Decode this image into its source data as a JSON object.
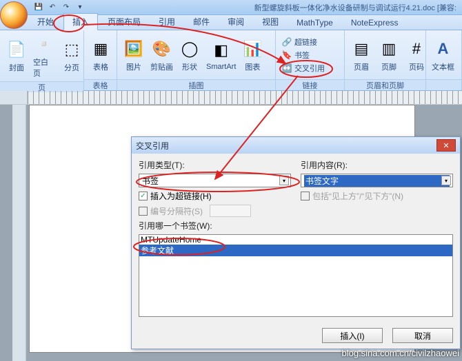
{
  "title_doc": "新型螺旋斜板一体化净水设备研制与调试运行4.21.doc [兼容:",
  "tabs": {
    "t0": "开始",
    "t1": "插入",
    "t2": "页面布局",
    "t3": "引用",
    "t4": "邮件",
    "t5": "审阅",
    "t6": "视图",
    "t7": "MathType",
    "t8": "NoteExpress"
  },
  "groups": {
    "pages": "页",
    "cover": "封面",
    "blank": "空白页",
    "pagebreak": "分页",
    "tables": "表格",
    "table": "表格",
    "illus": "插图",
    "picture": "图片",
    "clipart": "剪贴画",
    "shapes": "形状",
    "smartart": "SmartArt",
    "chart": "图表",
    "links": "链接",
    "hyperlink": "超链接",
    "bookmark": "书签",
    "crossref": "交叉引用",
    "hf": "页眉和页脚",
    "header": "页眉",
    "footer": "页脚",
    "pagenum": "页码",
    "textbox": "文本框"
  },
  "dialog": {
    "title": "交叉引用",
    "reftype_label": "引用类型(T):",
    "reftype_value": "书签",
    "refcontent_label": "引用内容(R):",
    "refcontent_value": "书签文字",
    "insert_as_hyperlink": "插入为超链接(H)",
    "include_above_below": "包括“见上方”/“见下方”(N)",
    "number_separator": "编号分隔符(S)",
    "which_label": "引用哪一个书签(W):",
    "list_item0": "MTUpdateHome",
    "list_item1": "参考文献",
    "btn_insert": "插入(I)",
    "btn_cancel": "取消"
  },
  "watermark": "blog.sina.com.cn/civilzhaowei"
}
